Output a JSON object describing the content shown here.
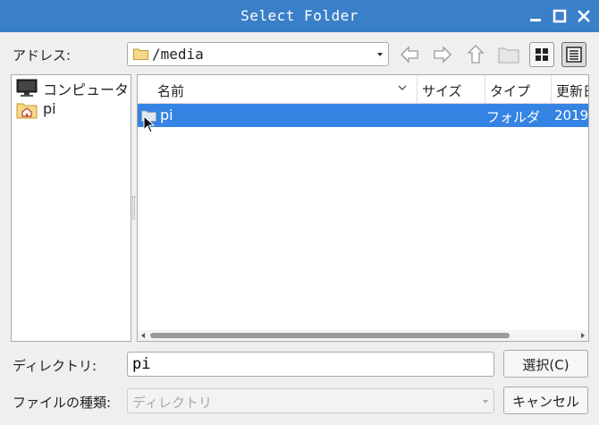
{
  "window": {
    "title": "Select Folder",
    "accent_color": "#3a80c8"
  },
  "toolbar": {
    "address_label": "アドレス:",
    "address_value": "/media",
    "buttons": [
      "back-icon",
      "forward-icon",
      "up-icon",
      "new-folder-icon",
      "icon-view-icon",
      "list-view-icon"
    ]
  },
  "sidebar": {
    "items": [
      {
        "label": "コンピュータ",
        "icon": "computer-icon"
      },
      {
        "label": "pi",
        "icon": "home-folder-icon"
      }
    ]
  },
  "file_list": {
    "columns": [
      "名前",
      "サイズ",
      "タイプ",
      "更新日"
    ],
    "rows": [
      {
        "name": "pi",
        "size": "",
        "type": "フォルダ",
        "date": "2019",
        "selected": true
      }
    ],
    "selection_color": "#3584e4"
  },
  "footer": {
    "directory_label": "ディレクトリ:",
    "directory_value": "pi",
    "file_type_label": "ファイルの種類:",
    "file_type_value": "ディレクトリ",
    "select_button": "選択(C)",
    "cancel_button": "キャンセル"
  }
}
